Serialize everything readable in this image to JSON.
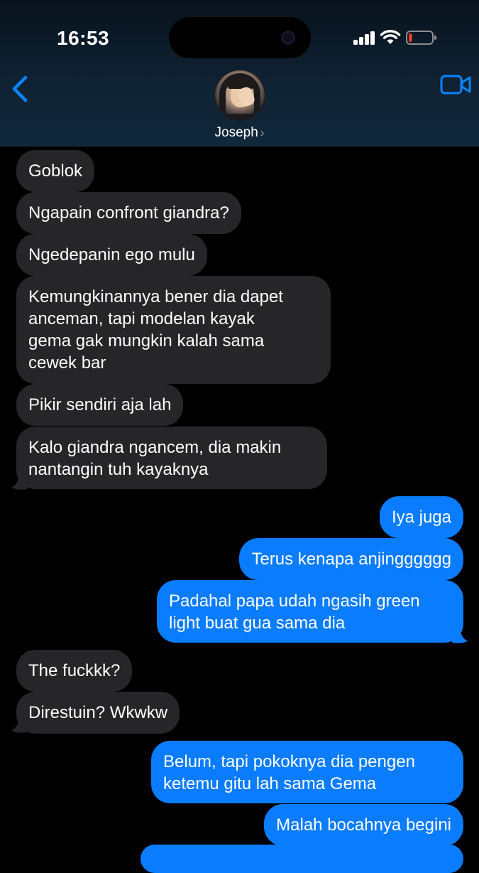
{
  "status_bar": {
    "time": "16:53"
  },
  "header": {
    "contact_name": "Joseph",
    "chevron": "›"
  },
  "icons": {
    "back": "chevron-left-icon",
    "video": "video-camera-icon",
    "signal": "cellular-signal-icon",
    "wifi": "wifi-icon",
    "battery": "battery-low-icon"
  },
  "colors": {
    "incoming_bubble": "#262628",
    "outgoing_bubble": "#0a7cff",
    "accent": "#0a84ff",
    "battery_low": "#ff3b30"
  },
  "battery_level": 0.15,
  "messages": [
    {
      "from": "them",
      "lines": [
        "Goblok"
      ]
    },
    {
      "from": "them",
      "lines": [
        "Ngapain confront giandra?"
      ]
    },
    {
      "from": "them",
      "lines": [
        "Ngedepanin ego mulu"
      ]
    },
    {
      "from": "them",
      "lines": [
        "Kemungkinannya bener dia dapet",
        "anceman, tapi modelan kayak",
        "gema gak mungkin kalah sama",
        "cewek bar"
      ]
    },
    {
      "from": "them",
      "lines": [
        "Pikir sendiri aja lah"
      ]
    },
    {
      "from": "them",
      "lines": [
        "Kalo giandra ngancem, dia makin",
        "nantangin tuh kayaknya"
      ]
    },
    {
      "from": "me",
      "lines": [
        "Iya juga"
      ]
    },
    {
      "from": "me",
      "lines": [
        "Terus kenapa anjingggggg"
      ]
    },
    {
      "from": "me",
      "lines": [
        "Padahal papa udah ngasih green",
        "light buat gua sama dia"
      ]
    },
    {
      "from": "them",
      "lines": [
        "The fuckkk?"
      ]
    },
    {
      "from": "them",
      "lines": [
        "Direstuin? Wkwkw"
      ]
    },
    {
      "from": "me",
      "lines": [
        "Belum, tapi pokoknya dia pengen",
        "ketemu gitu lah sama Gema"
      ]
    },
    {
      "from": "me",
      "lines": [
        "Malah bocahnya begini"
      ]
    }
  ]
}
